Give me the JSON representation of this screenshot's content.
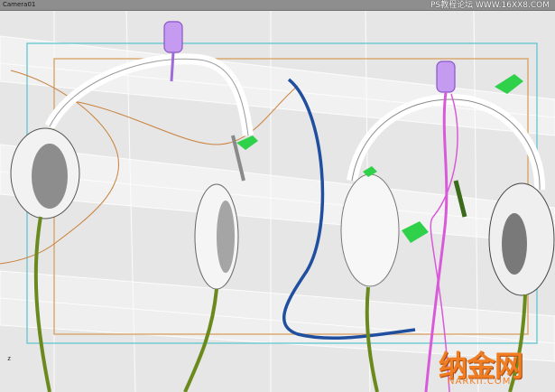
{
  "viewport": {
    "camera_label": "Camera01",
    "watermark_top": "PS教程论坛 WWW.16XX8.COM",
    "watermark_brand": "纳金网",
    "watermark_url": "NARKII.COM",
    "axis_label": "z"
  },
  "colors": {
    "background": "#e6e6e6",
    "safe_frame_outer": "#6cc7d2",
    "safe_frame_inner": "#d9a56a",
    "cable_blue": "#1f4f9e",
    "cable_pink": "#d95ad9",
    "cable_green": "#6b8a1e",
    "accent_green": "#2fd14a",
    "mic_purple": "#a06ad8",
    "watermark_orange": "#f07d22"
  }
}
